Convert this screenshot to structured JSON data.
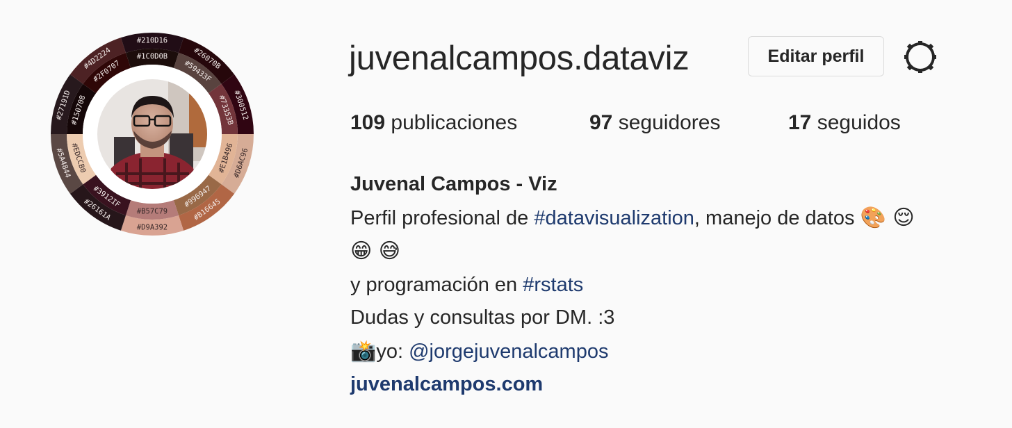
{
  "profile": {
    "username": "juvenalcampos.dataviz",
    "edit_button": "Editar perfil",
    "settings_icon": "gear-icon"
  },
  "stats": {
    "posts_count": "109",
    "posts_label": "publicaciones",
    "followers_count": "97",
    "followers_label": "seguidores",
    "following_count": "17",
    "following_label": "seguidos"
  },
  "bio": {
    "name": "Juvenal Campos - Viz",
    "line1_text": "Perfil profesional de ",
    "line1_tag": "#datavisualization",
    "line1_rest": ", manejo de datos ",
    "line1_emojis": "🎨 😌",
    "line2_emojis": "😁 😅",
    "line3_text": "y programación en ",
    "line3_tag": "#rstats",
    "line4_text": "Dudas y consultas por DM. :3",
    "line5_emoji": "📸",
    "line5_text": "yo: ",
    "line5_mention": "@jorgejuvenalcampos",
    "website": "juvenalcampos.com"
  },
  "avatar": {
    "outer_ring": [
      {
        "label": "#26070B",
        "color": "#26070b"
      },
      {
        "label": "#300512",
        "color": "#300512"
      },
      {
        "label": "#D6AC96",
        "color": "#d6ac96"
      },
      {
        "label": "#B16645",
        "color": "#b16645"
      },
      {
        "label": "#D9A392",
        "color": "#d9a392"
      },
      {
        "label": "#26161A",
        "color": "#26161a"
      },
      {
        "label": "#5A4844",
        "color": "#5a4844"
      },
      {
        "label": "#27191D",
        "color": "#27191d"
      },
      {
        "label": "#4D2224",
        "color": "#4d2224"
      },
      {
        "label": "#210D16",
        "color": "#210d16"
      }
    ],
    "inner_ring": [
      {
        "label": "#59433F",
        "color": "#59433f"
      },
      {
        "label": "#73353B",
        "color": "#73353b"
      },
      {
        "label": "#E1B496",
        "color": "#e1b496"
      },
      {
        "label": "#996947",
        "color": "#996947"
      },
      {
        "label": "#B57C79",
        "color": "#b57c79"
      },
      {
        "label": "#3912IF",
        "color": "#39121f"
      },
      {
        "label": "#EDCCB0",
        "color": "#edccb0"
      },
      {
        "label": "#150708",
        "color": "#150708"
      },
      {
        "label": "#2F0707",
        "color": "#2f0707"
      },
      {
        "label": "#1C0D0B",
        "color": "#1c0d0b"
      }
    ]
  },
  "colors": {
    "link": "#1e3a6e",
    "text": "#262626",
    "background": "#fafafa",
    "button_border": "#dbdbdb"
  }
}
